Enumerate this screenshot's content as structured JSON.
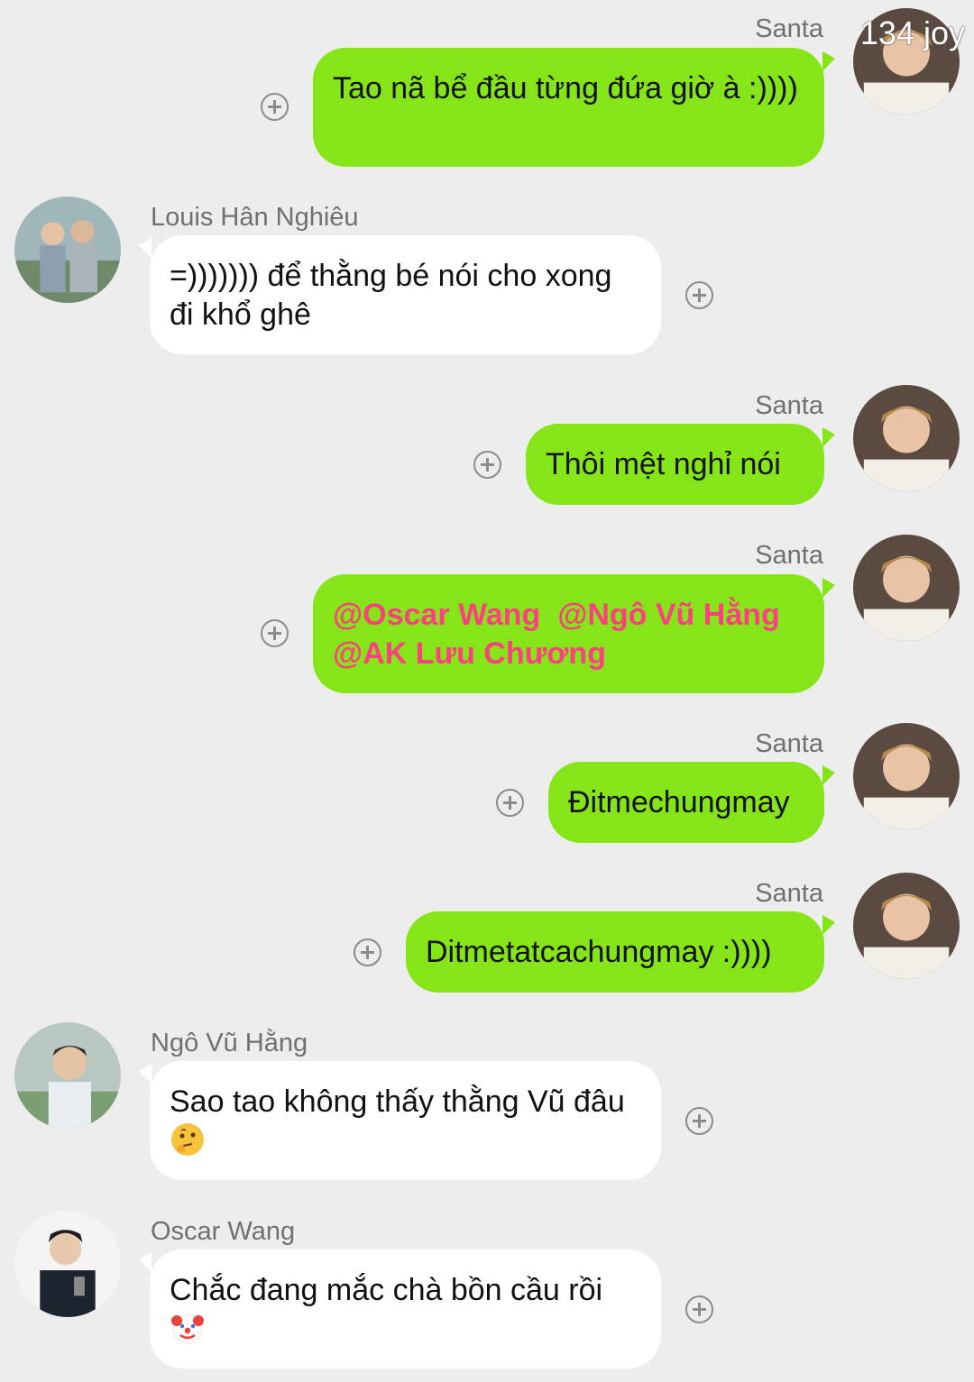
{
  "watermark": "134 joy",
  "messages": [
    {
      "sender": "Santa",
      "side": "out",
      "text": "Tao nã bể đầu từng đứa giờ à :))))"
    },
    {
      "sender": "Louis Hân Nghiêu",
      "side": "in",
      "text": "=))))))) để thằng bé nói cho xong đi khổ ghê"
    },
    {
      "sender": "Santa",
      "side": "out",
      "text": "Thôi mệt nghỉ nói"
    },
    {
      "sender": "Santa",
      "side": "out",
      "mentions": [
        "@Oscar Wang",
        "@Ngô Vũ Hằng",
        "@AK Lưu Chương"
      ]
    },
    {
      "sender": "Santa",
      "side": "out",
      "text": "Đitmechungmay"
    },
    {
      "sender": "Santa",
      "side": "out",
      "text": "Ditmetatcachungmay :))))"
    },
    {
      "sender": "Ngô Vũ Hằng",
      "side": "in",
      "text": "Sao tao không thấy thằng Vũ đâu",
      "emoji": "thinking-face"
    },
    {
      "sender": "Oscar Wang",
      "side": "in",
      "text": "Chắc đang mắc chà bồn cầu rồi",
      "emoji": "clown-face"
    }
  ]
}
